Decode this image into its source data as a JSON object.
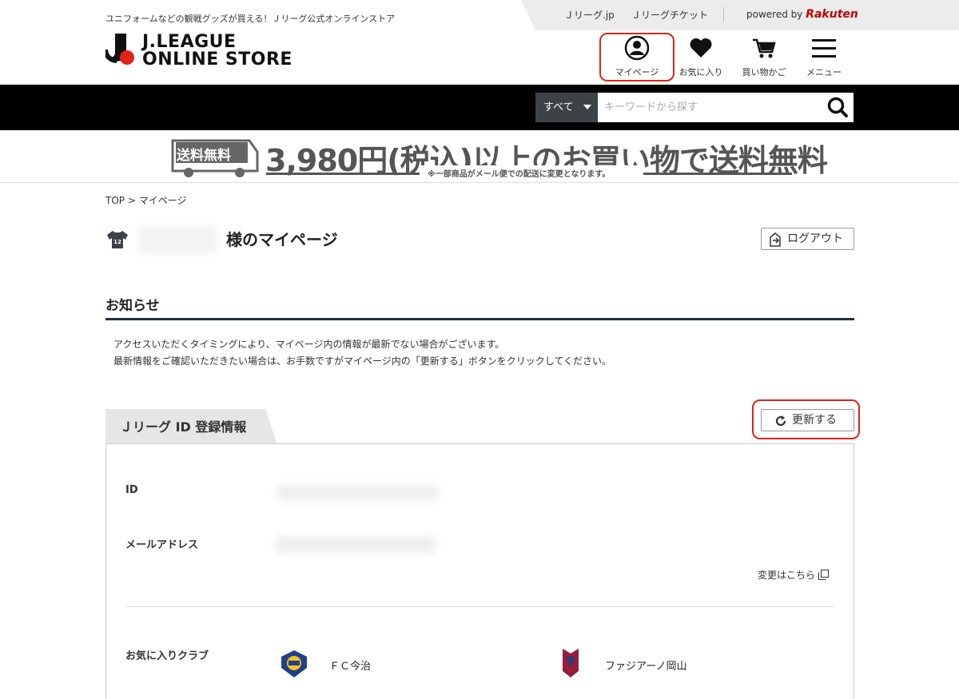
{
  "header": {
    "tagline": "ユニフォームなどの観戦グッズが買える！Ｊリーグ公式オンラインストア",
    "top_links": [
      "Ｊリーグ.jp",
      "Ｊリーグチケット"
    ],
    "powered_by": "powered by",
    "rakuten": "Rakuten",
    "logo_line1": "J.LEAGUE",
    "logo_line2": "ONLINE STORE",
    "icons": {
      "mypage": "マイページ",
      "favorites": "お気に入り",
      "cart": "買い物かご",
      "menu": "メニュー"
    }
  },
  "search": {
    "category": "すべて",
    "placeholder": "キーワードから探す"
  },
  "banner": {
    "badge": "送料無料",
    "main": "3,980円(税込)以上のお買い物で送料無料",
    "note": "※一部商品がメール便での配送に変更となります。"
  },
  "breadcrumb": "TOP > マイページ",
  "page_title": "様のマイページ",
  "logout_label": "ログアウト",
  "notice": {
    "heading": "お知らせ",
    "line1": "アクセスいただくタイミングにより、マイページ内の情報が最新でない場合がございます。",
    "line2": "最新情報をご確認いただきたい場合は、お手数ですがマイページ内の「更新する」ボタンをクリックしてください。"
  },
  "jleague_id": {
    "tab_label": "Ｊリーグ ID 登録情報",
    "refresh_label": "更新する",
    "id_label": "ID",
    "email_label": "メールアドレス",
    "change_link": "変更はこちら",
    "favorite_clubs_label": "お気に入りクラブ",
    "clubs": [
      "ＦＣ今治",
      "ファジアーノ岡山"
    ]
  },
  "colors": {
    "highlight_ring": "#e2231a",
    "nav_dark": "#233042",
    "rakuten_red": "#bf0000"
  }
}
